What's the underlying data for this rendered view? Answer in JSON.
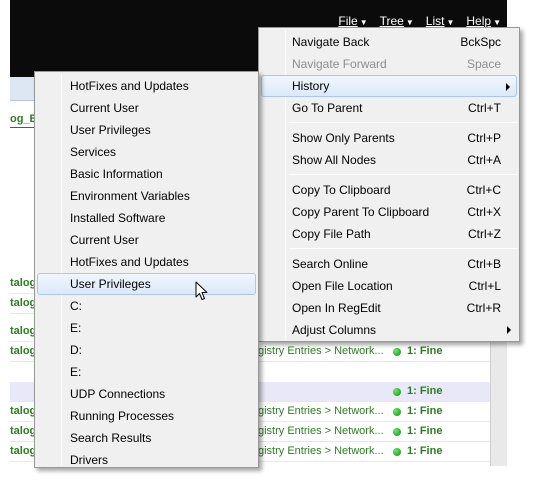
{
  "menubar": [
    {
      "label": "File"
    },
    {
      "label": "Tree"
    },
    {
      "label": "List"
    },
    {
      "label": "Help"
    }
  ],
  "background": {
    "path_tab": "og_E",
    "rows": [
      {
        "left": "talog",
        "mid": "",
        "status": ""
      },
      {
        "left": "talog",
        "mid": "",
        "status": ""
      },
      {
        "left": "talog",
        "mid": "",
        "status": ""
      },
      {
        "left": "talog",
        "mid": "gistry Entries > Network...",
        "status": "1: Fine"
      },
      {
        "left": "",
        "mid": "",
        "status": "1: Fine"
      },
      {
        "left": "talog",
        "mid": "gistry Entries > Network...",
        "status": "1: Fine"
      },
      {
        "left": "talog",
        "mid": "gistry Entries > Network...",
        "status": "1: Fine"
      },
      {
        "left": "talog",
        "mid": "gistry Entries > Network...",
        "status": "1: Fine"
      }
    ]
  },
  "main_menu": {
    "items": [
      {
        "label": "Navigate Back",
        "shortcut": "BckSpc"
      },
      {
        "label": "Navigate Forward",
        "shortcut": "Space"
      },
      {
        "label": "History",
        "shortcut": ""
      },
      {
        "label": "Go To Parent",
        "shortcut": "Ctrl+T"
      },
      {
        "label": "Show Only Parents",
        "shortcut": "Ctrl+P"
      },
      {
        "label": "Show All Nodes",
        "shortcut": "Ctrl+A"
      },
      {
        "label": "Copy To Clipboard",
        "shortcut": "Ctrl+C"
      },
      {
        "label": "Copy Parent To Clipboard",
        "shortcut": "Ctrl+X"
      },
      {
        "label": "Copy File Path",
        "shortcut": "Ctrl+Z"
      },
      {
        "label": "Search Online",
        "shortcut": "Ctrl+B"
      },
      {
        "label": "Open File Location",
        "shortcut": "Ctrl+L"
      },
      {
        "label": "Open In RegEdit",
        "shortcut": "Ctrl+R"
      },
      {
        "label": "Adjust Columns",
        "shortcut": ""
      }
    ]
  },
  "history_menu": {
    "items": [
      {
        "label": "HotFixes and Updates"
      },
      {
        "label": "Current User"
      },
      {
        "label": "User Privileges"
      },
      {
        "label": "Services"
      },
      {
        "label": "Basic Information"
      },
      {
        "label": "Environment Variables"
      },
      {
        "label": "Installed Software"
      },
      {
        "label": "Current User"
      },
      {
        "label": "HotFixes and Updates"
      },
      {
        "label": "User Privileges"
      },
      {
        "label": "C:"
      },
      {
        "label": "E:"
      },
      {
        "label": "D:"
      },
      {
        "label": "E:"
      },
      {
        "label": "UDP Connections"
      },
      {
        "label": "Running Processes"
      },
      {
        "label": "Search Results"
      },
      {
        "label": "Drivers"
      }
    ]
  },
  "colors": {
    "status_green": "#2f7d24",
    "menu_bg": "#f0f0f0",
    "hover_border": "#a8c8ee"
  }
}
